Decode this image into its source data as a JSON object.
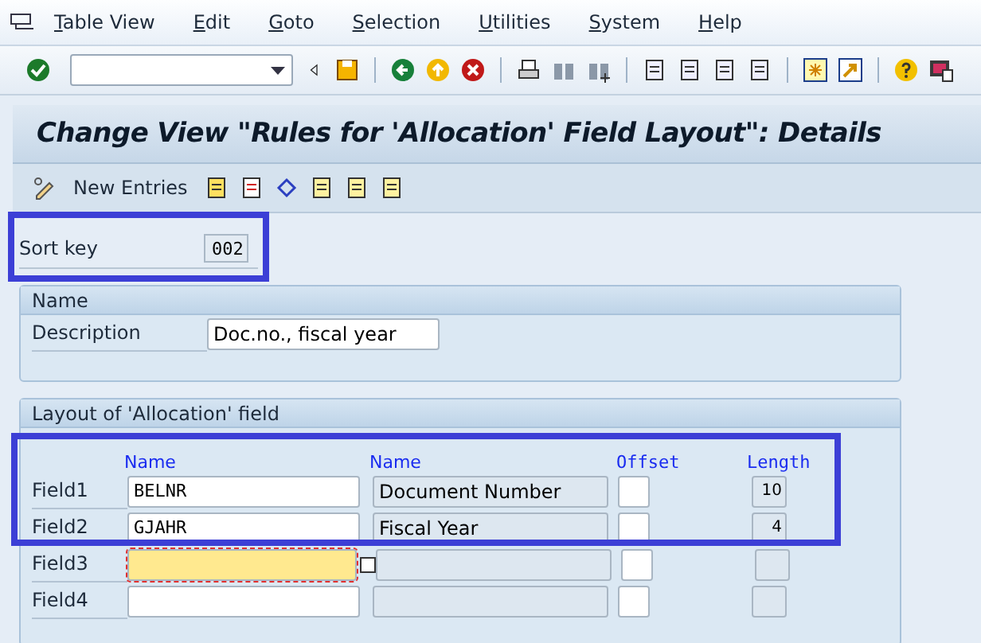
{
  "menu": [
    "Table View",
    "Edit",
    "Goto",
    "Selection",
    "Utilities",
    "System",
    "Help"
  ],
  "title": "Change View \"Rules for 'Allocation' Field Layout\": Details",
  "app_toolbar": {
    "new_entries": "New Entries"
  },
  "sort_key": {
    "label": "Sort key",
    "value": "002"
  },
  "name_group": {
    "title": "Name",
    "label": "Description",
    "value": "Doc.no., fiscal year"
  },
  "layout_group": {
    "title": "Layout of 'Allocation' field",
    "columns": [
      "Name",
      "Name",
      "Offset",
      "Length"
    ],
    "rows": [
      {
        "label": "Field1",
        "name": "BELNR",
        "description": "Document Number",
        "length": "10",
        "focused": false
      },
      {
        "label": "Field2",
        "name": "GJAHR",
        "description": "Fiscal Year",
        "length": "4",
        "focused": false
      },
      {
        "label": "Field3",
        "focused": true
      },
      {
        "label": "Field4",
        "focused": false
      }
    ]
  }
}
